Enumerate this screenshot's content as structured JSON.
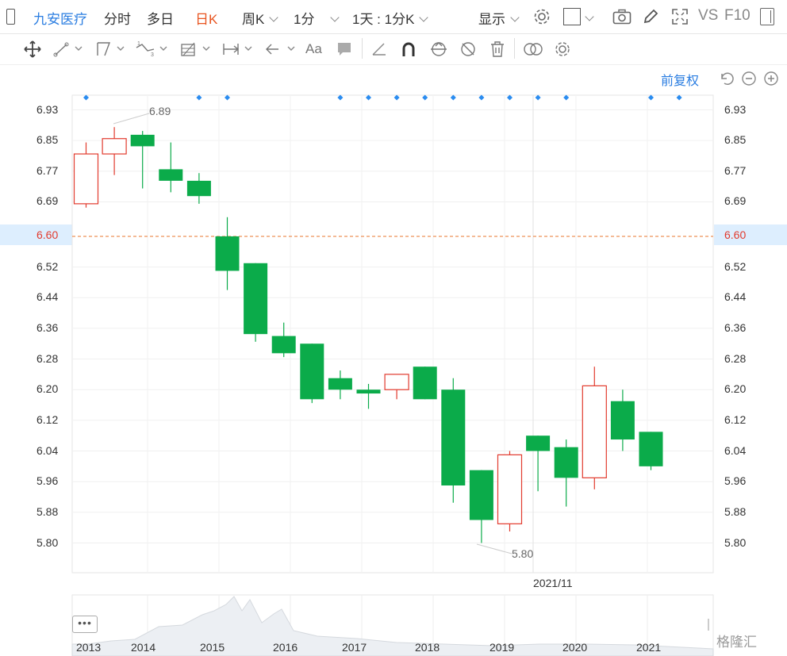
{
  "topbar": {
    "stock_name": "九安医疗",
    "tabs": [
      "分时",
      "多日",
      "日K",
      "周K",
      "1分"
    ],
    "active_tab": "日K",
    "interval_select": "1天 : 1分K",
    "display_label": "显示",
    "vs_label": "VS",
    "f10_label": "F10"
  },
  "adjust_label": "前复权",
  "current_price": "6.60",
  "y_ticks": [
    "6.93",
    "6.85",
    "6.77",
    "6.69",
    "6.60",
    "6.52",
    "6.44",
    "6.36",
    "6.28",
    "6.20",
    "6.12",
    "6.04",
    "5.96",
    "5.88",
    "5.80"
  ],
  "max_label": "6.89",
  "min_label": "5.80",
  "cursor_date": "2021/11",
  "x_ticks": [
    "2013",
    "2014",
    "2015",
    "2016",
    "2017",
    "2018",
    "2019",
    "2020",
    "2021"
  ],
  "dots_label": "•••",
  "watermark": "格隆汇",
  "chart_data": {
    "type": "candlestick",
    "y_range": [
      5.76,
      6.97
    ],
    "candles": [
      {
        "o": 6.685,
        "c": 6.815,
        "h": 6.845,
        "l": 6.675,
        "up": true
      },
      {
        "o": 6.815,
        "c": 6.855,
        "h": 6.885,
        "l": 6.76,
        "up": true
      },
      {
        "o": 6.865,
        "c": 6.835,
        "h": 6.875,
        "l": 6.725,
        "up": false
      },
      {
        "o": 6.775,
        "c": 6.745,
        "h": 6.845,
        "l": 6.715,
        "up": false
      },
      {
        "o": 6.745,
        "c": 6.705,
        "h": 6.765,
        "l": 6.685,
        "up": false
      },
      {
        "o": 6.6,
        "c": 6.51,
        "h": 6.65,
        "l": 6.46,
        "up": false
      },
      {
        "o": 6.53,
        "c": 6.345,
        "h": 6.53,
        "l": 6.325,
        "up": false
      },
      {
        "o": 6.34,
        "c": 6.295,
        "h": 6.375,
        "l": 6.285,
        "up": false
      },
      {
        "o": 6.32,
        "c": 6.175,
        "h": 6.32,
        "l": 6.165,
        "up": false
      },
      {
        "o": 6.23,
        "c": 6.2,
        "h": 6.25,
        "l": 6.175,
        "up": false
      },
      {
        "o": 6.2,
        "c": 6.19,
        "h": 6.215,
        "l": 6.15,
        "up": false
      },
      {
        "o": 6.2,
        "c": 6.24,
        "h": 6.24,
        "l": 6.175,
        "up": true
      },
      {
        "o": 6.26,
        "c": 6.175,
        "h": 6.26,
        "l": 6.175,
        "up": false
      },
      {
        "o": 6.2,
        "c": 5.95,
        "h": 6.23,
        "l": 5.905,
        "up": false
      },
      {
        "o": 5.99,
        "c": 5.86,
        "h": 5.99,
        "l": 5.8,
        "up": false
      },
      {
        "o": 5.85,
        "c": 6.03,
        "h": 6.04,
        "l": 5.83,
        "up": true
      },
      {
        "o": 6.08,
        "c": 6.04,
        "h": 6.08,
        "l": 5.935,
        "up": false
      },
      {
        "o": 6.05,
        "c": 5.97,
        "h": 6.07,
        "l": 5.895,
        "up": false
      },
      {
        "o": 5.97,
        "c": 6.21,
        "h": 6.26,
        "l": 5.94,
        "up": true
      },
      {
        "o": 6.17,
        "c": 6.07,
        "h": 6.2,
        "l": 6.04,
        "up": false
      },
      {
        "o": 6.09,
        "c": 6.0,
        "h": 6.09,
        "l": 5.99,
        "up": false
      }
    ],
    "event_marker_slots": [
      0,
      4,
      5,
      9,
      10,
      11,
      12,
      13,
      14,
      15,
      16,
      17,
      20,
      21
    ]
  },
  "colors": {
    "up": "#e23a2d",
    "down": "#0bab4a",
    "accent": "#2a7de1",
    "price_line": "#e8762d",
    "marker": "#2a8cf0"
  }
}
